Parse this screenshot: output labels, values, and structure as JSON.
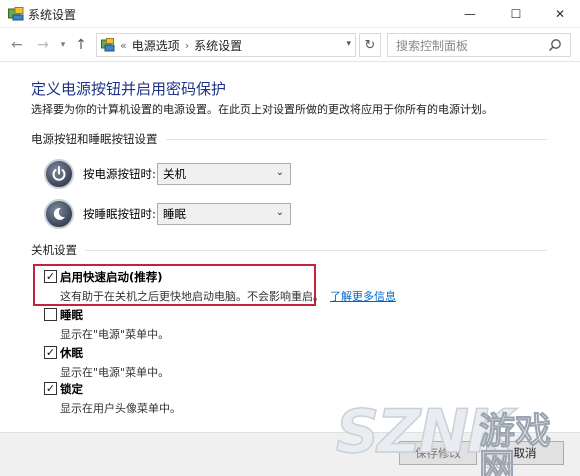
{
  "window": {
    "title": "系统设置"
  },
  "window_controls": {
    "minimize": "—",
    "maximize": "☐",
    "close": "✕"
  },
  "address_bar": {
    "back": "←",
    "forward": "→",
    "history": "▾",
    "up": "↑",
    "chevrons": "«",
    "crumbs": [
      "电源选项",
      "系统设置"
    ],
    "separator": "›",
    "dropdown": "▾",
    "refresh": "↻",
    "search_placeholder": "搜索控制面板"
  },
  "main": {
    "title": "定义电源按钮并启用密码保护",
    "description": "选择要为你的计算机设置的电源设置。在此页上对设置所做的更改将应用于你所有的电源计划。",
    "power_section": {
      "heading": "电源按钮和睡眠按钮设置",
      "rows": [
        {
          "label": "按电源按钮时:",
          "value": "关机",
          "icon": "power-icon"
        },
        {
          "label": "按睡眠按钮时:",
          "value": "睡眠",
          "icon": "moon-icon"
        }
      ]
    },
    "shutdown_section": {
      "heading": "关机设置",
      "items": [
        {
          "label": "启用快速启动(推荐)",
          "checked": true,
          "description": "这有助于在关机之后更快地启动电脑。不会影响重启。",
          "link": "了解更多信息"
        },
        {
          "label": "睡眠",
          "checked": false,
          "description": "显示在\"电源\"菜单中。"
        },
        {
          "label": "休眠",
          "checked": true,
          "description": "显示在\"电源\"菜单中。"
        },
        {
          "label": "锁定",
          "checked": true,
          "description": "显示在用户头像菜单中。"
        }
      ],
      "check_mark": "✓"
    }
  },
  "footer": {
    "save_label": "保存修改",
    "cancel_label": "取消"
  },
  "watermark": {
    "latin": "SZNK",
    "cn": "游戏网",
    "url": ".com"
  },
  "colors": {
    "title_blue": "#1e3287",
    "link_blue": "#0066cc",
    "highlight_red": "#c4243a"
  }
}
